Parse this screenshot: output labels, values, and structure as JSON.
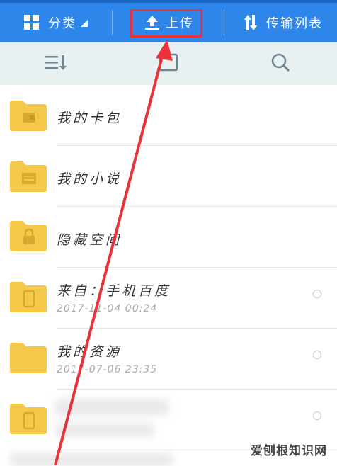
{
  "topbar": {
    "category_label": "分类",
    "upload_label": "上传",
    "transfer_label": "传输列表"
  },
  "folders": [
    {
      "name": "我的卡包",
      "date": "",
      "icon": "wallet-icon"
    },
    {
      "name": "我的小说",
      "date": "",
      "icon": "book-icon"
    },
    {
      "name": "隐藏空间",
      "date": "",
      "icon": "lock-icon"
    },
    {
      "name": "来自：手机百度",
      "date": "2017-11-04 00:24",
      "icon": "phone-icon"
    },
    {
      "name": "我的资源",
      "date": "2017-07-06 23:35",
      "icon": "none"
    },
    {
      "name": "",
      "date": "",
      "icon": "phone-icon"
    }
  ],
  "watermark": "爱刨根知识网",
  "colors": {
    "topbar": "#2f86ea",
    "highlight": "#e8333a",
    "folder": "#f5c84a",
    "toolbar": "#e9f0f2"
  }
}
